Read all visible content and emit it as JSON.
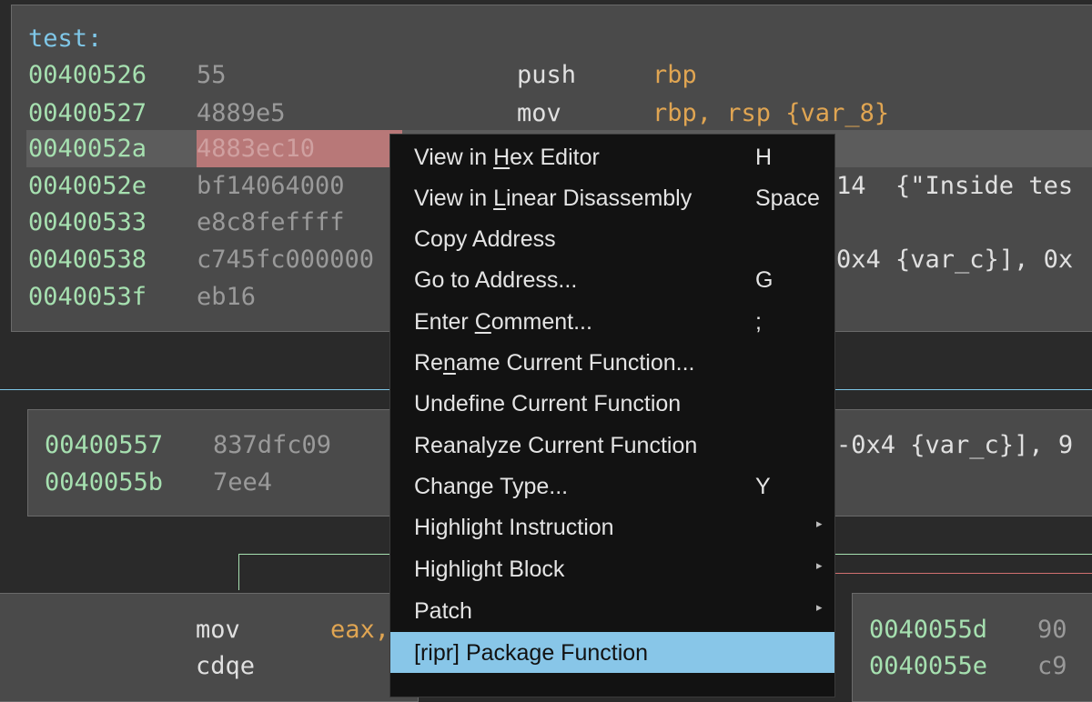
{
  "block1": {
    "label": "test:",
    "rows": [
      {
        "addr": "00400526",
        "bytes": "55",
        "mnem": "push",
        "operands": "rbp"
      },
      {
        "addr": "00400527",
        "bytes": "4889e5",
        "mnem": "mov",
        "operands": "rbp, rsp {var_8}"
      },
      {
        "addr": "0040052a",
        "bytes": "4883ec10",
        "mnem": "",
        "operands": ""
      },
      {
        "addr": "0040052e",
        "bytes": "bf14064000",
        "mnem": "",
        "operands": "14  {\"Inside tes"
      },
      {
        "addr": "00400533",
        "bytes": "e8c8feffff",
        "mnem": "",
        "operands": ""
      },
      {
        "addr": "00400538",
        "bytes": "c745fc000000",
        "mnem": "",
        "operands": "0x4 {var_c}], 0x"
      },
      {
        "addr": "0040053f",
        "bytes": "eb16",
        "mnem": "",
        "operands": ""
      }
    ]
  },
  "block2": {
    "rows": [
      {
        "addr": "00400557",
        "bytes": "837dfc09",
        "operands": "-0x4 {var_c}], 9"
      },
      {
        "addr": "0040055b",
        "bytes": "7ee4",
        "operands": ""
      }
    ]
  },
  "block3": {
    "rows": [
      {
        "mnem": "mov",
        "operands": "eax,"
      },
      {
        "mnem": "cdqe",
        "operands": ""
      }
    ]
  },
  "block4": {
    "rows": [
      {
        "addr": "0040055d",
        "bytes": "90"
      },
      {
        "addr": "0040055e",
        "bytes": "c9"
      }
    ]
  },
  "menu": {
    "items": [
      {
        "pre": "View in ",
        "u": "H",
        "post": "ex Editor",
        "shortcut": "H",
        "submenu": false
      },
      {
        "pre": "View in ",
        "u": "L",
        "post": "inear Disassembly",
        "shortcut": "Space",
        "submenu": false
      },
      {
        "pre": "Copy Address",
        "u": "",
        "post": "",
        "shortcut": "",
        "submenu": false
      },
      {
        "pre": "Go to Address...",
        "u": "",
        "post": "",
        "shortcut": "G",
        "submenu": false
      },
      {
        "pre": "Enter ",
        "u": "C",
        "post": "omment...",
        "shortcut": ";",
        "submenu": false
      },
      {
        "pre": "Re",
        "u": "n",
        "post": "ame Current Function...",
        "shortcut": "",
        "submenu": false
      },
      {
        "pre": "Undefine Current Function",
        "u": "",
        "post": "",
        "shortcut": "",
        "submenu": false
      },
      {
        "pre": "Reanalyze Current Function",
        "u": "",
        "post": "",
        "shortcut": "",
        "submenu": false
      },
      {
        "pre": "Change Type...",
        "u": "",
        "post": "",
        "shortcut": "Y",
        "submenu": false
      },
      {
        "pre": "Highlight Instruction",
        "u": "",
        "post": "",
        "shortcut": "",
        "submenu": true
      },
      {
        "pre": "Highlight Block",
        "u": "",
        "post": "",
        "shortcut": "",
        "submenu": true
      },
      {
        "pre": "Patch",
        "u": "",
        "post": "",
        "shortcut": "",
        "submenu": true
      },
      {
        "pre": "[ripr] Package Function",
        "u": "",
        "post": "",
        "shortcut": "",
        "submenu": false,
        "active": true
      }
    ],
    "arrow_glyph": "▸"
  },
  "colors": {
    "address": "#a6e0b0",
    "bytes": "#9a9a9a",
    "register": "#e0a552",
    "label": "#7fc7e8",
    "menu_highlight": "#88c6e8"
  }
}
